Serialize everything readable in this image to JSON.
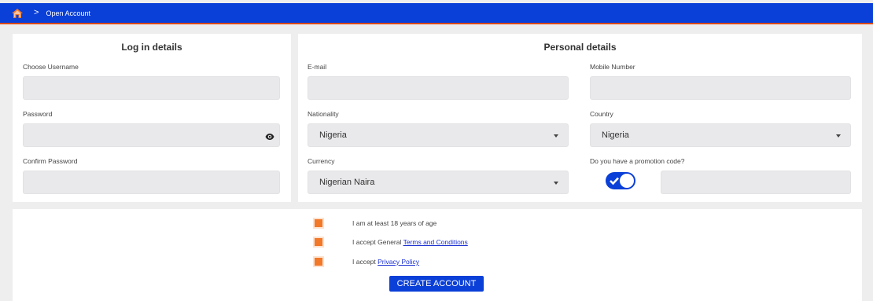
{
  "header": {
    "home_icon": "home-icon",
    "separator": ">",
    "breadcrumb": "Open Account",
    "accent_color": "#0a3fd8",
    "home_icon_color": "#f2782a"
  },
  "login": {
    "title": "Log in details",
    "username_label": "Choose Username",
    "username_value": "",
    "password_label": "Password",
    "password_value": "",
    "confirm_label": "Confirm Password",
    "confirm_value": ""
  },
  "personal": {
    "title": "Personal details",
    "email_label": "E-mail",
    "email_value": "",
    "mobile_label": "Mobile Number",
    "mobile_value": "",
    "nationality_label": "Nationality",
    "nationality_value": "Nigeria",
    "country_label": "Country",
    "country_value": "Nigeria",
    "currency_label": "Currency",
    "currency_value": "Nigerian Naira",
    "promo_label": "Do you have a promotion code?",
    "promo_toggle_on": true,
    "promo_value": ""
  },
  "agreements": {
    "age_text": "I am at least 18 years of age",
    "terms_prefix": "I accept General ",
    "terms_link": "Terms and Conditions",
    "privacy_prefix": "I accept ",
    "privacy_link": "Privacy Policy",
    "checkbox_color": "#f2782a"
  },
  "create_button": "CREATE ACCOUNT"
}
